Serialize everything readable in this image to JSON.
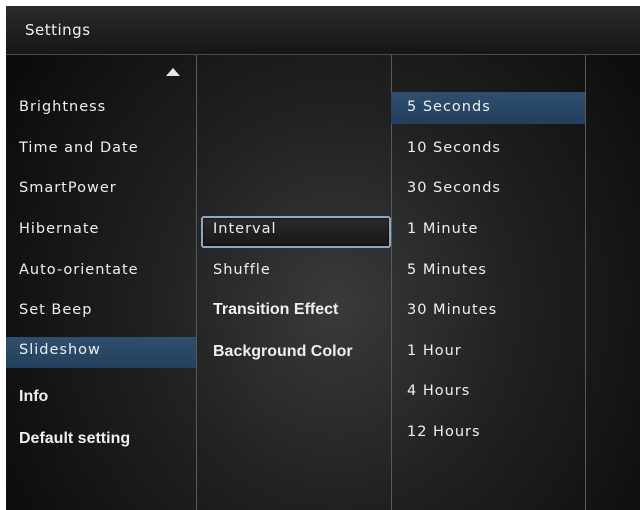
{
  "header": {
    "title": "Settings"
  },
  "left_menu": {
    "items": [
      {
        "label": "Brightness"
      },
      {
        "label": "Time and Date"
      },
      {
        "label": "SmartPower"
      },
      {
        "label": "Hibernate"
      },
      {
        "label": "Auto-orientate"
      },
      {
        "label": "Set Beep"
      },
      {
        "label": "Slideshow"
      },
      {
        "label": "Info"
      },
      {
        "label": "Default setting"
      }
    ],
    "selected": "Slideshow"
  },
  "middle_menu": {
    "items": [
      {
        "label": "Interval"
      },
      {
        "label": "Shuffle"
      },
      {
        "label": "Transition Effect"
      },
      {
        "label": "Background Color"
      }
    ],
    "focused": "Interval"
  },
  "right_menu": {
    "items": [
      {
        "label": "5 Seconds"
      },
      {
        "label": "10 Seconds"
      },
      {
        "label": "30 Seconds"
      },
      {
        "label": "1 Minute"
      },
      {
        "label": "5 Minutes"
      },
      {
        "label": "30 Minutes"
      },
      {
        "label": "1 Hour"
      },
      {
        "label": "4 Hours"
      },
      {
        "label": "12 Hours"
      }
    ],
    "selected": "5 Seconds"
  },
  "icons": {
    "scroll_up": "triangle-up-icon"
  },
  "colors": {
    "selection": "#2a4866",
    "focus_border": "#8fa9c4",
    "text": "#efefef"
  }
}
